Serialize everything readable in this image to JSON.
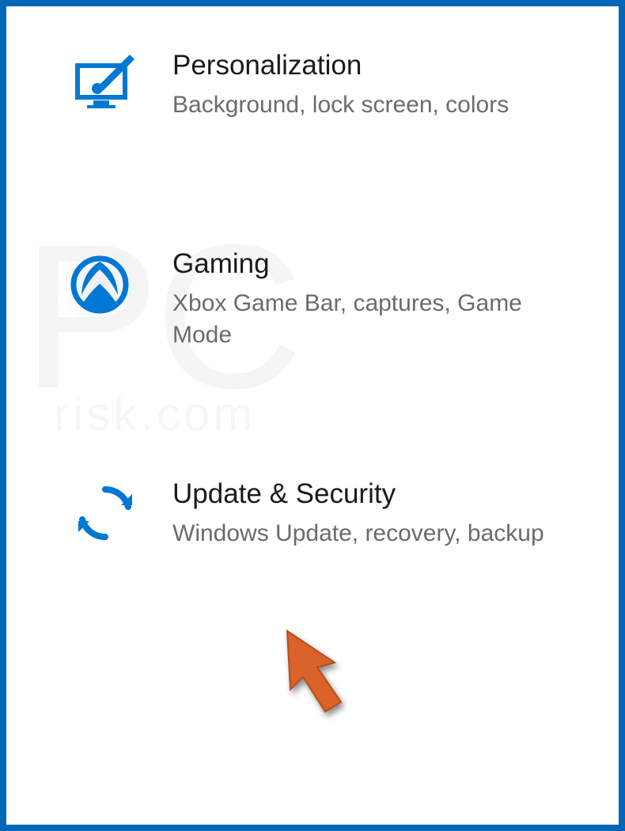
{
  "settings": {
    "items": [
      {
        "icon": "personalization-icon",
        "title": "Personalization",
        "description": "Background, lock screen, colors"
      },
      {
        "icon": "gaming-icon",
        "title": "Gaming",
        "description": "Xbox Game Bar, captures, Game Mode"
      },
      {
        "icon": "update-security-icon",
        "title": "Update & Security",
        "description": "Windows Update, recovery, backup"
      }
    ]
  },
  "watermark": {
    "main": "PC",
    "sub": "risk.com"
  },
  "colors": {
    "accent": "#0067b8",
    "icon": "#0078d4",
    "text": "#1a1a1a",
    "muted": "#6b6b6b",
    "arrow": "#d9632a"
  }
}
